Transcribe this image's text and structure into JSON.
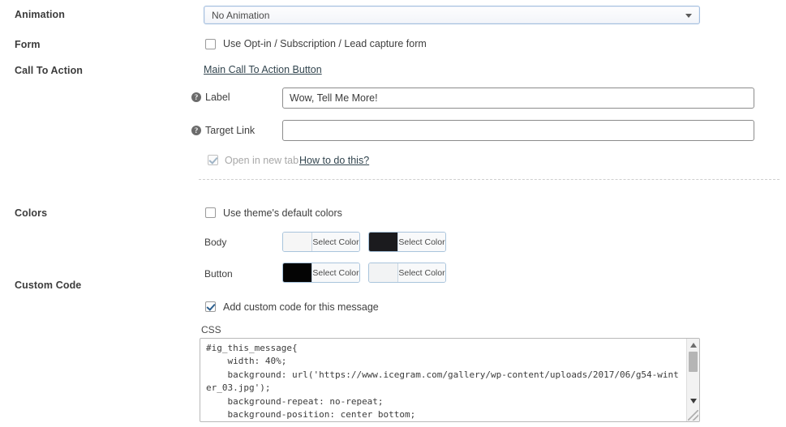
{
  "rows": {
    "animation": {
      "label": "Animation"
    },
    "form": {
      "label": "Form"
    },
    "cta": {
      "label": "Call To Action"
    },
    "colors": {
      "label": "Colors"
    },
    "custom_code": {
      "label": "Custom Code"
    }
  },
  "animation": {
    "selected": "No Animation",
    "caret_icon": "chevron-down-icon"
  },
  "form": {
    "checkbox_label": "Use Opt-in / Subscription / Lead capture form",
    "checked": false
  },
  "cta": {
    "link_text": "Main Call To Action Button",
    "label_field": {
      "help_icon": "help-circle-icon",
      "label": "Label",
      "value": "Wow, Tell Me More!"
    },
    "target_field": {
      "help_icon": "help-circle-icon",
      "label": "Target Link",
      "value": "",
      "placeholder": ""
    },
    "new_tab": {
      "label": "Open in new tab",
      "checked": true,
      "disabled": true
    },
    "how_to_link": "How to do this?"
  },
  "colors": {
    "default_colors": {
      "label": "Use theme's default colors",
      "checked": false
    },
    "button_label": "Select Color",
    "rows": [
      {
        "name": "Body",
        "swatches": [
          "#f6f6f6",
          "#1b1b1e"
        ]
      },
      {
        "name": "Button",
        "swatches": [
          "#040404",
          "#f2f3f4"
        ]
      }
    ]
  },
  "custom_code": {
    "checkbox_label": "Add custom code for this message",
    "checked": true,
    "css_label": "CSS",
    "css_value": "#ig_this_message{\n    width: 40%;\n    background: url('https://www.icegram.com/gallery/wp-content/uploads/2017/06/g54-winter_03.jpg');\n    background-repeat: no-repeat;\n    background-position: center bottom;",
    "scrollbar": {
      "up_icon": "scroll-up-arrow-icon",
      "down_icon": "scroll-down-arrow-icon",
      "resize_icon": "resize-grip-icon"
    }
  }
}
